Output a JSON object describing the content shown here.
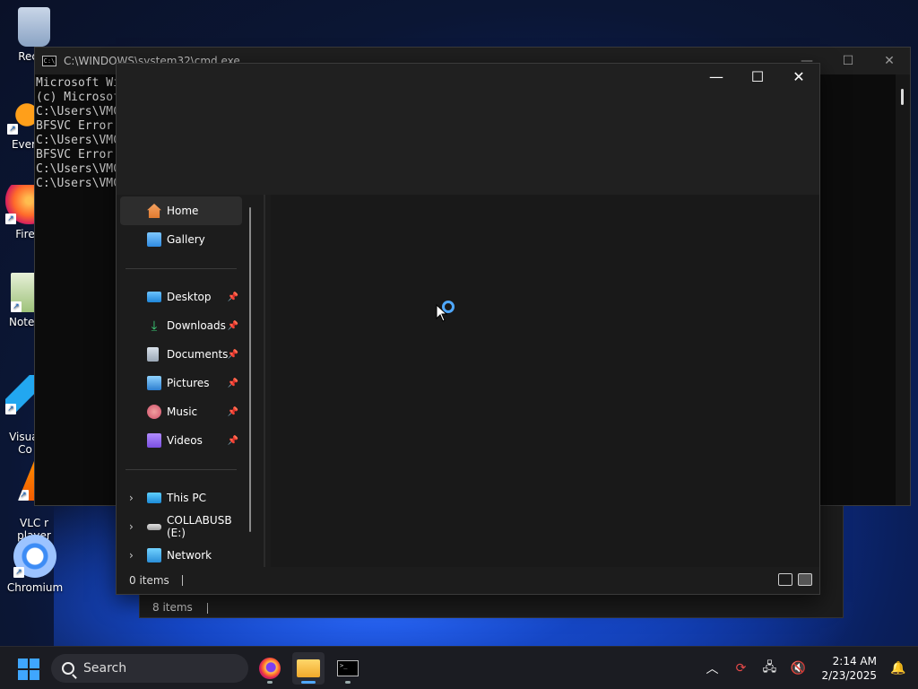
{
  "desktop": {
    "icons": [
      {
        "label": "Recyc",
        "icon": "recycle-bin-icon"
      },
      {
        "label": "Every",
        "icon": "everything-icon"
      },
      {
        "label": "Fire",
        "icon": "firefox-icon"
      },
      {
        "label": "Notep",
        "icon": "notepad-icon"
      },
      {
        "label": "Visual\nCo",
        "icon": "vscode-icon"
      },
      {
        "label": "VLC r\nplayer",
        "icon": "vlc-icon"
      },
      {
        "label": "Chromium",
        "icon": "chromium-icon"
      }
    ]
  },
  "cmd": {
    "title": "C:\\WINDOWS\\system32\\cmd.exe",
    "lines": [
      "Microsoft Wi",
      "(c) Microsof",
      "",
      "C:\\Users\\VMC",
      "BFSVC Error",
      "",
      "C:\\Users\\VMC",
      "BFSVC Error",
      "",
      "C:\\Users\\VMC",
      "C:\\Users\\VMC"
    ]
  },
  "explorer": {
    "nav": {
      "top": [
        {
          "label": "Home",
          "icon": "home-icon"
        },
        {
          "label": "Gallery",
          "icon": "gallery-icon"
        }
      ],
      "quick": [
        {
          "label": "Desktop",
          "icon": "desktop-folder-icon"
        },
        {
          "label": "Downloads",
          "icon": "downloads-folder-icon"
        },
        {
          "label": "Documents",
          "icon": "documents-folder-icon"
        },
        {
          "label": "Pictures",
          "icon": "pictures-folder-icon"
        },
        {
          "label": "Music",
          "icon": "music-folder-icon"
        },
        {
          "label": "Videos",
          "icon": "videos-folder-icon"
        }
      ],
      "drives": [
        {
          "label": "This PC",
          "icon": "this-pc-icon"
        },
        {
          "label": "COLLABUSB (E:)",
          "icon": "usb-drive-icon"
        },
        {
          "label": "Network",
          "icon": "network-icon"
        }
      ]
    },
    "status": "0 items"
  },
  "background_window": {
    "status": "8 items"
  },
  "taskbar": {
    "search_label": "Search",
    "time": "2:14 AM",
    "date": "2/23/2025"
  }
}
